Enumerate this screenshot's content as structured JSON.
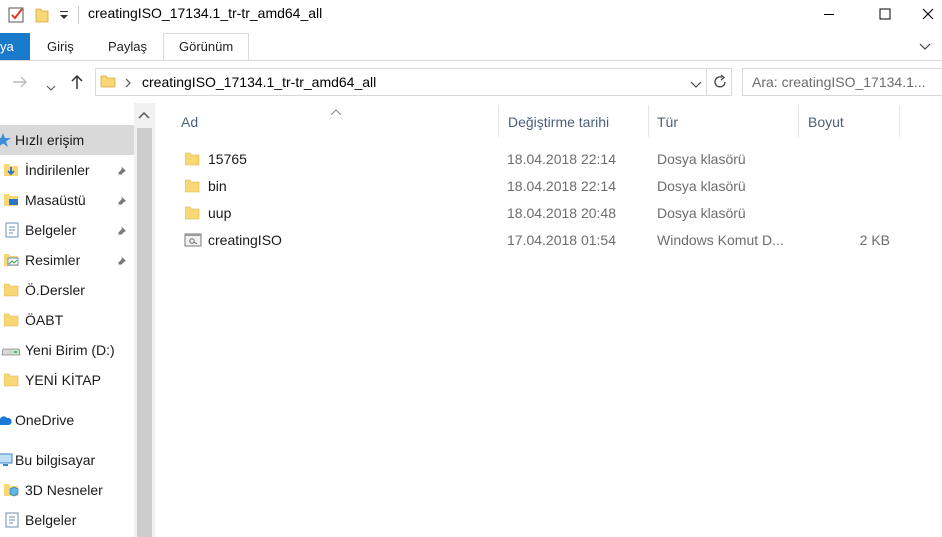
{
  "window": {
    "title": "creatingISO_17134.1_tr-tr_amd64_all"
  },
  "ribbon": {
    "tabs": [
      {
        "label": "ya"
      },
      {
        "label": "Giriş"
      },
      {
        "label": "Paylaş"
      },
      {
        "label": "Görünüm"
      }
    ]
  },
  "address": {
    "path": "creatingISO_17134.1_tr-tr_amd64_all"
  },
  "search": {
    "placeholder": "Ara: creatingISO_17134.1..."
  },
  "sidebar": {
    "items": [
      {
        "label": "Hızlı erişim",
        "icon": "star-icon"
      },
      {
        "label": "İndirilenler",
        "icon": "download-folder-icon",
        "pinned": true
      },
      {
        "label": "Masaüstü",
        "icon": "desktop-folder-icon",
        "pinned": true
      },
      {
        "label": "Belgeler",
        "icon": "documents-icon",
        "pinned": true
      },
      {
        "label": "Resimler",
        "icon": "pictures-icon",
        "pinned": true
      },
      {
        "label": "Ö.Dersler",
        "icon": "folder-icon"
      },
      {
        "label": "ÖABT",
        "icon": "folder-icon"
      },
      {
        "label": "Yeni Birim (D:)",
        "icon": "drive-icon"
      },
      {
        "label": "YENİ KİTAP",
        "icon": "folder-icon"
      },
      {
        "label": "OneDrive",
        "icon": "cloud-icon"
      },
      {
        "label": "Bu bilgisayar",
        "icon": "computer-icon"
      },
      {
        "label": "3D Nesneler",
        "icon": "3d-objects-icon"
      },
      {
        "label": "Belgeler",
        "icon": "documents-icon"
      }
    ]
  },
  "table": {
    "columns": [
      "Ad",
      "Değiştirme tarihi",
      "Tür",
      "Boyut"
    ],
    "rows": [
      {
        "name": "15765",
        "date": "18.04.2018 22:14",
        "type": "Dosya klasörü",
        "size": "",
        "icon": "folder-icon"
      },
      {
        "name": "bin",
        "date": "18.04.2018 22:14",
        "type": "Dosya klasörü",
        "size": "",
        "icon": "folder-icon"
      },
      {
        "name": "uup",
        "date": "18.04.2018 20:48",
        "type": "Dosya klasörü",
        "size": "",
        "icon": "folder-icon"
      },
      {
        "name": "creatingISO",
        "date": "17.04.2018 01:54",
        "type": "Windows Komut D...",
        "size": "2 KB",
        "icon": "batch-file-icon"
      }
    ]
  },
  "colors": {
    "accent": "#1979ca",
    "folder": "#f8d775",
    "header_text": "#4c607a"
  }
}
